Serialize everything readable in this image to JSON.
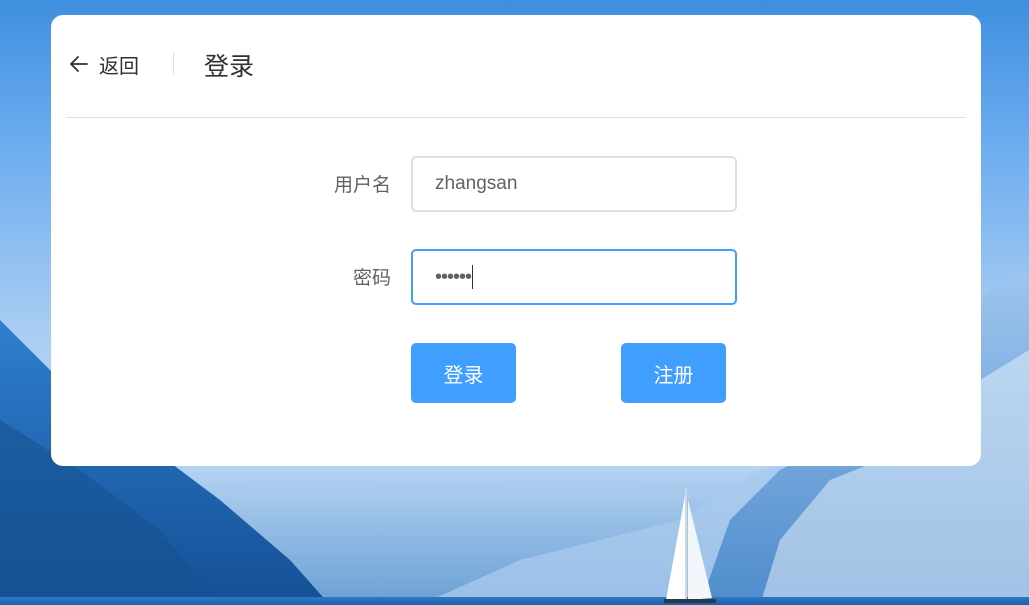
{
  "header": {
    "back_label": "返回",
    "title": "登录"
  },
  "form": {
    "username": {
      "label": "用户名",
      "value": "zhangsan"
    },
    "password": {
      "label": "密码",
      "value": "••••••"
    }
  },
  "buttons": {
    "login": "登录",
    "register": "注册"
  },
  "colors": {
    "primary": "#409eff",
    "text": "#303133",
    "label": "#606266",
    "border": "#dcdfe6"
  }
}
